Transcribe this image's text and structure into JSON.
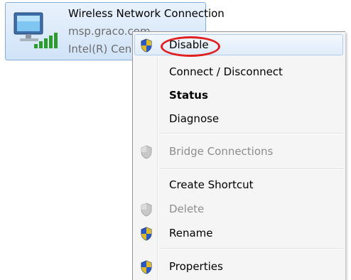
{
  "adapter": {
    "name": "Wireless Network Connection",
    "network": "msp.graco.com",
    "device": "Intel(R) Cen"
  },
  "context_menu": {
    "items": [
      {
        "label": "Disable",
        "shield": true,
        "state": "hover"
      },
      {
        "label": "Connect / Disconnect"
      },
      {
        "label": "Status",
        "bold": true
      },
      {
        "label": "Diagnose"
      },
      {
        "label": "Bridge Connections",
        "shield": true,
        "disabled": true
      },
      {
        "label": "Create Shortcut"
      },
      {
        "label": "Delete",
        "shield": true,
        "disabled": true
      },
      {
        "label": "Rename",
        "shield": true
      },
      {
        "label": "Properties",
        "shield": true
      }
    ]
  },
  "annotation": {
    "circled_item": "Disable",
    "color": "#e02020"
  },
  "colors": {
    "selection_border": "#84acdd",
    "menu_bg": "#f5f5f5"
  }
}
